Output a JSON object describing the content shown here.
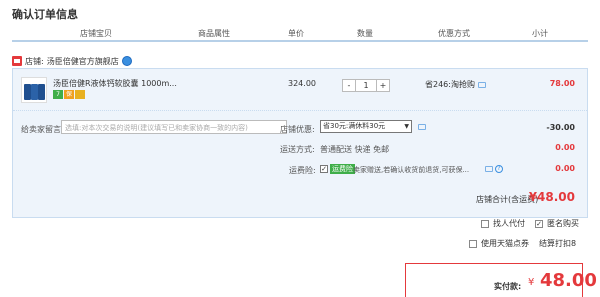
{
  "page": {
    "title": "确认订单信息"
  },
  "columns": [
    "店铺宝贝",
    "商品属性",
    "单价",
    "数量",
    "优惠方式",
    "小计"
  ],
  "shop": {
    "label": "店铺:",
    "name": "汤臣倍健官方旗舰店"
  },
  "product": {
    "name": "汤臣倍健R液体钙软胶囊 1000m...",
    "price": "324.00",
    "qty": "1",
    "minus": "-",
    "plus": "+",
    "discount": "省246:淘抢购",
    "subtotal": "78.00"
  },
  "message": {
    "label": "给卖家留言:",
    "placeholder": "选填:对本次交易的说明(建议填写已和卖家协商一致的内容)"
  },
  "shop_discount": {
    "label": "店铺优惠:",
    "selected": "省30元:满休料30元",
    "value": "-30.00"
  },
  "shipping": {
    "label": "运送方式:",
    "text": "普通配送 快递 免邮",
    "value": "0.00"
  },
  "insurance": {
    "label": "运费险:",
    "tag": "运费险",
    "text": "卖家赠送,若确认收货前退货,可获保...",
    "value": "0.00",
    "help": "?"
  },
  "shop_total": {
    "label": "店铺合计(含运费)",
    "value": "¥48.00"
  },
  "options": {
    "proxy_pay": "找人代付",
    "anonymous": "匿名购买",
    "tmall_points": "使用天猫点券",
    "settle": "结算打扣8"
  },
  "payment": {
    "label": "实付款:",
    "currency": "¥",
    "amount": "48.00"
  },
  "colors": {
    "accent": "#e4393c",
    "box_bg": "#eef4fb",
    "border": "#c9dcf0"
  }
}
